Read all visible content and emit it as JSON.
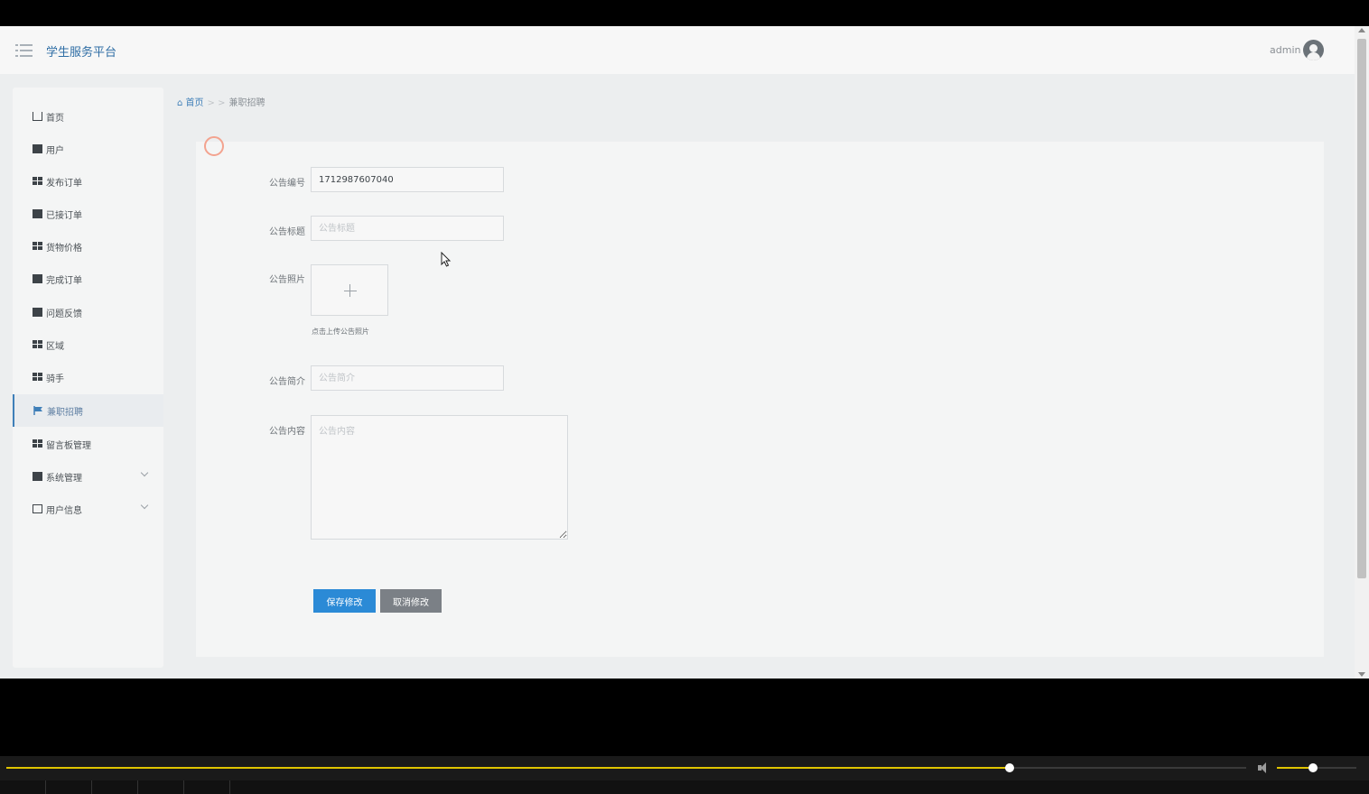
{
  "header": {
    "brand": "学生服务平台",
    "username": "admin"
  },
  "sidebar": {
    "items": [
      {
        "label": "首页",
        "icon": "home-icon"
      },
      {
        "label": "用户",
        "icon": "user-card-icon"
      },
      {
        "label": "发布订单",
        "icon": "grid-icon"
      },
      {
        "label": "已接订单",
        "icon": "clipboard-icon"
      },
      {
        "label": "货物价格",
        "icon": "grid-icon"
      },
      {
        "label": "完成订单",
        "icon": "monitor-icon"
      },
      {
        "label": "问题反馈",
        "icon": "chart-icon"
      },
      {
        "label": "区域",
        "icon": "grid-icon"
      },
      {
        "label": "骑手",
        "icon": "grid-icon"
      },
      {
        "label": "兼职招聘",
        "icon": "flag-icon",
        "active": true
      },
      {
        "label": "留言板管理",
        "icon": "grid-icon"
      },
      {
        "label": "系统管理",
        "icon": "briefcase-icon",
        "expandable": true
      },
      {
        "label": "用户信息",
        "icon": "card-icon",
        "expandable": true
      }
    ]
  },
  "breadcrumb": {
    "home": "首页",
    "separator": "> >",
    "current": "兼职招聘"
  },
  "form": {
    "number_label": "公告编号",
    "number_value": "1712987607040",
    "title_label": "公告标题",
    "title_placeholder": "公告标题",
    "photo_label": "公告照片",
    "photo_hint": "点击上传公告照片",
    "intro_label": "公告简介",
    "intro_placeholder": "公告简介",
    "content_label": "公告内容",
    "content_placeholder": "公告内容",
    "save_label": "保存修改",
    "cancel_label": "取消修改"
  },
  "player": {
    "progress": 0.809,
    "volume": 0.45
  },
  "colors": {
    "brand": "#2f6ea5",
    "primary_button": "#2b8ad6",
    "secondary_button": "#7b8086",
    "progress": "#e0c400"
  }
}
